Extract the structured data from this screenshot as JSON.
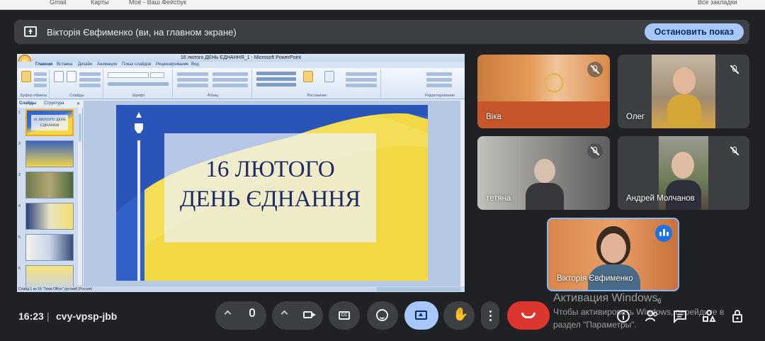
{
  "browser_strip": {
    "tabs": [
      "Gmail",
      "Карты",
      "Моё - Ваш Фейсбук",
      "Все закладки"
    ]
  },
  "present_bar": {
    "text": "Вікторія Євфименко (ви, на главном экране)",
    "stop_label": "Остановить показ"
  },
  "powerpoint": {
    "title": "16 лютого ДЕНЬ ЄДНАННЯ_1 - Microsoft PowerPoint",
    "tabs": [
      "Главная",
      "Вставка",
      "Дизайн",
      "Анимация",
      "Показ слайдов",
      "Рецензирование",
      "Вид"
    ],
    "groups": [
      "Буфер обмена",
      "Слайды",
      "Шрифт",
      "Абзац",
      "Рисование",
      "Редактирование"
    ],
    "side_tabs": [
      "Слайды",
      "Структура"
    ],
    "thumb_numbers": [
      "1",
      "2",
      "3",
      "4",
      "5",
      "6"
    ],
    "thumb1_text": "16 ЛЮТОГО ДЕНЬ ЄДНАННЯ",
    "status": "Слайд 1 из 16   \"Тема Office\"   русский (Россия)",
    "slide_line1": "16 ЛЮТОГО",
    "slide_line2": "ДЕНЬ ЄДНАННЯ"
  },
  "participants": [
    {
      "name": "Віка",
      "muted": true
    },
    {
      "name": "Олег",
      "muted": true
    },
    {
      "name": "тетяна",
      "muted": true
    },
    {
      "name": "Андрей Молчанов",
      "muted": true
    },
    {
      "name": "Вікторія Євфименко",
      "muted": false,
      "speaking": true
    }
  ],
  "bottom_bar": {
    "time": "16:23",
    "separator": "|",
    "meeting_code": "cvy-vpsp-jbb",
    "more_badge": "6"
  },
  "watermark": {
    "title": "Активация Windows",
    "line1": "Чтобы активировать Windows, перейдите в",
    "line2": "раздел \"Параметры\"."
  },
  "colors": {
    "accent": "#a8c7fa",
    "hangup": "#dc362e",
    "background": "#202124"
  }
}
